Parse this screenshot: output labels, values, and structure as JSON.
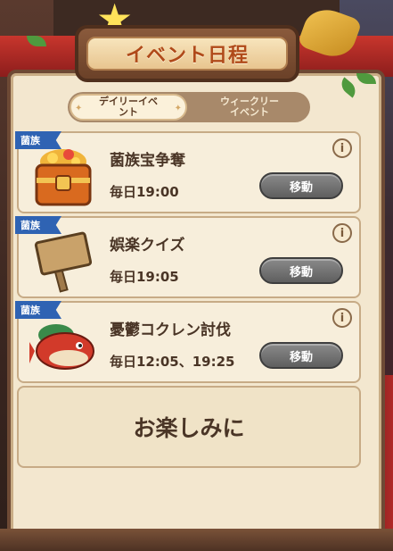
{
  "title": "イベント日程",
  "tabs": [
    {
      "label": "デイリーイベ\nント",
      "active": true
    },
    {
      "label": "ウィークリー\nイベント",
      "active": false
    }
  ],
  "events": [
    {
      "badge": "菌族",
      "name": "菌族宝争奪",
      "time": "毎日19:00",
      "button": "移動",
      "icon": "treasure-chest-icon"
    },
    {
      "badge": "菌族",
      "name": "娯楽クイズ",
      "time": "毎日19:05",
      "button": "移動",
      "icon": "wooden-sign-icon"
    },
    {
      "badge": "菌族",
      "name": "憂鬱コクレン討伐",
      "time": "毎日12:05、19:25",
      "button": "移動",
      "icon": "red-fish-monster-icon"
    }
  ],
  "info_symbol": "i",
  "coming_soon": "お楽しみに",
  "colors": {
    "badge": "#2f63b3",
    "title_text": "#b04a1a",
    "button": "#6e6e6e",
    "panel": "#f3e7cf"
  }
}
